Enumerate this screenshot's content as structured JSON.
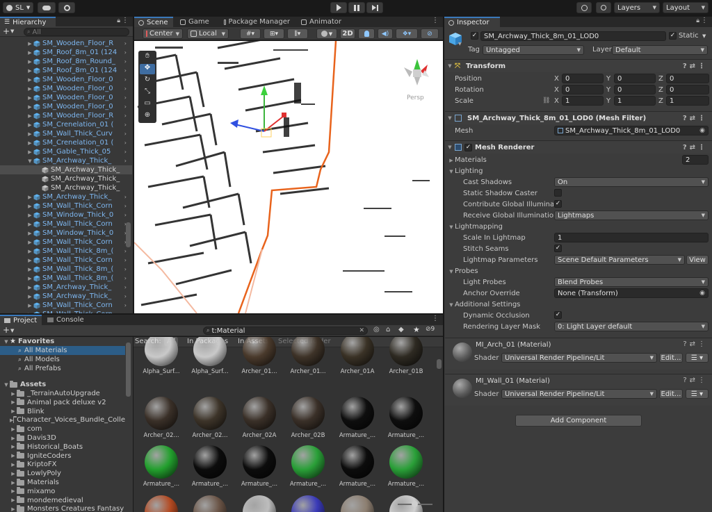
{
  "toolbar": {
    "account": "SL",
    "layers": "Layers",
    "layout": "Layout"
  },
  "hierarchy": {
    "tab": "Hierarchy",
    "search_placeholder": "All",
    "items": [
      {
        "label": "SM_Wooden_Floor_R",
        "indent": 1,
        "expand": "right",
        "selected": false
      },
      {
        "label": "SM_Roof_8m_01 (124",
        "indent": 1,
        "expand": "right",
        "selected": false
      },
      {
        "label": "SM_Roof_8m_Round_",
        "indent": 1,
        "expand": "right",
        "selected": false
      },
      {
        "label": "SM_Roof_8m_01 (124",
        "indent": 1,
        "expand": "right",
        "selected": false
      },
      {
        "label": "SM_Wooden_Floor_0",
        "indent": 1,
        "expand": "right",
        "selected": false
      },
      {
        "label": "SM_Wooden_Floor_0",
        "indent": 1,
        "expand": "right",
        "selected": false
      },
      {
        "label": "SM_Wooden_Floor_0",
        "indent": 1,
        "expand": "right",
        "selected": false
      },
      {
        "label": "SM_Wooden_Floor_0",
        "indent": 1,
        "expand": "right",
        "selected": false
      },
      {
        "label": "SM_Wooden_Floor_R",
        "indent": 1,
        "expand": "right",
        "selected": false
      },
      {
        "label": "SM_Crenelation_01 (",
        "indent": 1,
        "expand": "right",
        "selected": false
      },
      {
        "label": "SM_Wall_Thick_Curv",
        "indent": 1,
        "expand": "right",
        "selected": false
      },
      {
        "label": "SM_Crenelation_01 (",
        "indent": 1,
        "expand": "right",
        "selected": false
      },
      {
        "label": "SM_Gable_Thick_05",
        "indent": 1,
        "expand": "right",
        "selected": false
      },
      {
        "label": "SM_Archway_Thick_",
        "indent": 1,
        "expand": "down",
        "selected": false
      },
      {
        "label": "SM_Archway_Thick_",
        "indent": 2,
        "expand": "none",
        "selected": true
      },
      {
        "label": "SM_Archway_Thick_",
        "indent": 2,
        "expand": "none",
        "selected": false
      },
      {
        "label": "SM_Archway_Thick_",
        "indent": 2,
        "expand": "none",
        "selected": false
      },
      {
        "label": "SM_Archway_Thick_",
        "indent": 1,
        "expand": "right",
        "selected": false
      },
      {
        "label": "SM_Wall_Thick_Corn",
        "indent": 1,
        "expand": "right",
        "selected": false
      },
      {
        "label": "SM_Window_Thick_0",
        "indent": 1,
        "expand": "right",
        "selected": false
      },
      {
        "label": "SM_Wall_Thick_Corn",
        "indent": 1,
        "expand": "right",
        "selected": false
      },
      {
        "label": "SM_Window_Thick_0",
        "indent": 1,
        "expand": "right",
        "selected": false
      },
      {
        "label": "SM_Wall_Thick_Corn",
        "indent": 1,
        "expand": "right",
        "selected": false
      },
      {
        "label": "SM_Wall_Thick_8m_(",
        "indent": 1,
        "expand": "right",
        "selected": false
      },
      {
        "label": "SM_Wall_Thick_Corn",
        "indent": 1,
        "expand": "right",
        "selected": false
      },
      {
        "label": "SM_Wall_Thick_8m_(",
        "indent": 1,
        "expand": "right",
        "selected": false
      },
      {
        "label": "SM_Wall_Thick_8m_(",
        "indent": 1,
        "expand": "right",
        "selected": false
      },
      {
        "label": "SM_Archway_Thick_",
        "indent": 1,
        "expand": "right",
        "selected": false
      },
      {
        "label": "SM_Archway_Thick_",
        "indent": 1,
        "expand": "right",
        "selected": false
      },
      {
        "label": "SM_Wall_Thick_Corn",
        "indent": 1,
        "expand": "right",
        "selected": false
      },
      {
        "label": "SM_Wall_Thick_Corn",
        "indent": 1,
        "expand": "right",
        "selected": false
      }
    ]
  },
  "scene": {
    "tabs": [
      "Scene",
      "Game",
      "Package Manager",
      "Animator"
    ],
    "pivot": "Center",
    "space": "Local",
    "mode_2d": "2D",
    "persp": "Persp"
  },
  "project": {
    "tabs": [
      "Project",
      "Console"
    ],
    "search_value": "t:Material",
    "search_count": "9",
    "favorites_title": "Favorites",
    "favorites": [
      "All Materials",
      "All Models",
      "All Prefabs"
    ],
    "assets_title": "Assets",
    "folders": [
      "_TerrainAutoUpgrade",
      "Animal pack deluxe v2",
      "Blink",
      "Character_Voices_Bundle_Colle",
      "com",
      "Davis3D",
      "Historical_Boats",
      "IgniteCoders",
      "KriptoFX",
      "LowlyPoly",
      "Materials",
      "mixamo",
      "mondemedieval",
      "Monsters Creatures Fantasy"
    ],
    "search_label": "Search:",
    "filters": [
      "All",
      "In Packages",
      "In Assets",
      "Selected folder"
    ],
    "assets": [
      {
        "label": "Alpha_Surf...",
        "color": "#c9c9c9"
      },
      {
        "label": "Alpha_Surf...",
        "color": "#c9c9c9"
      },
      {
        "label": "Archer_01...",
        "color": "#4a3a2c"
      },
      {
        "label": "Archer_01...",
        "color": "#3e3328"
      },
      {
        "label": "Archer_01A",
        "color": "#3a3226"
      },
      {
        "label": "Archer_01B",
        "color": "#2e2a22"
      },
      {
        "label": "Archer_02...",
        "color": "#3a3028"
      },
      {
        "label": "Archer_02...",
        "color": "#3d3429"
      },
      {
        "label": "Archer_02A",
        "color": "#3a3028"
      },
      {
        "label": "Archer_02B",
        "color": "#3a3028"
      },
      {
        "label": "Armature_...",
        "color": "#0e0e0e"
      },
      {
        "label": "Armature_...",
        "color": "#0e0e0e"
      },
      {
        "label": "Armature_...",
        "color": "#23a02e"
      },
      {
        "label": "Armature_...",
        "color": "#0c0c0c"
      },
      {
        "label": "Armature_...",
        "color": "#0c0c0c"
      },
      {
        "label": "Armature_...",
        "color": "#2aa038"
      },
      {
        "label": "Armature_...",
        "color": "#0c0c0c"
      },
      {
        "label": "Armature_...",
        "color": "#2aa038"
      },
      {
        "label": "",
        "color": "#b34a22"
      },
      {
        "label": "",
        "color": "#6a5446"
      },
      {
        "label": "",
        "color": "#bdbdbd"
      },
      {
        "label": "",
        "color": "#3a3ab8"
      },
      {
        "label": "",
        "color": "#8c7e70"
      },
      {
        "label": "",
        "color": "#cfcfcf"
      }
    ]
  },
  "inspector": {
    "tab": "Inspector",
    "object_name": "SM_Archway_Thick_8m_01_LOD0",
    "static_label": "Static",
    "tag_label": "Tag",
    "tag_value": "Untagged",
    "layer_label": "Layer",
    "layer_value": "Default",
    "transform": {
      "title": "Transform",
      "position_label": "Position",
      "rotation_label": "Rotation",
      "scale_label": "Scale",
      "position": [
        "0",
        "0",
        "0"
      ],
      "rotation": [
        "0",
        "0",
        "0"
      ],
      "scale": [
        "1",
        "1",
        "1"
      ],
      "axes": [
        "X",
        "Y",
        "Z"
      ]
    },
    "mesh_filter": {
      "title": "SM_Archway_Thick_8m_01_LOD0 (Mesh Filter)",
      "mesh_label": "Mesh",
      "mesh_value": "SM_Archway_Thick_8m_01_LOD0"
    },
    "mesh_renderer": {
      "title": "Mesh Renderer",
      "materials_label": "Materials",
      "materials_count": "2",
      "lighting_label": "Lighting",
      "cast_shadows_label": "Cast Shadows",
      "cast_shadows_value": "On",
      "static_shadow_label": "Static Shadow Caster",
      "contribute_gi_label": "Contribute Global Illumination",
      "receive_gi_label": "Receive Global Illumination",
      "receive_gi_value": "Lightmaps",
      "lightmapping_label": "Lightmapping",
      "scale_lightmap_label": "Scale In Lightmap",
      "scale_lightmap_value": "1",
      "stitch_seams_label": "Stitch Seams",
      "lightmap_params_label": "Lightmap Parameters",
      "lightmap_params_value": "Scene Default Parameters",
      "view_label": "View",
      "probes_label": "Probes",
      "light_probes_label": "Light Probes",
      "light_probes_value": "Blend Probes",
      "anchor_label": "Anchor Override",
      "anchor_value": "None (Transform)",
      "additional_label": "Additional Settings",
      "dynamic_occ_label": "Dynamic Occlusion",
      "rendering_layer_label": "Rendering Layer Mask",
      "rendering_layer_value": "0: Light Layer default"
    },
    "materials": [
      {
        "title": "MI_Arch_01 (Material)",
        "shader_label": "Shader",
        "shader_value": "Universal Render Pipeline/Lit",
        "edit_label": "Edit..."
      },
      {
        "title": "MI_Wall_01 (Material)",
        "shader_label": "Shader",
        "shader_value": "Universal Render Pipeline/Lit",
        "edit_label": "Edit..."
      }
    ],
    "add_component": "Add Component"
  }
}
